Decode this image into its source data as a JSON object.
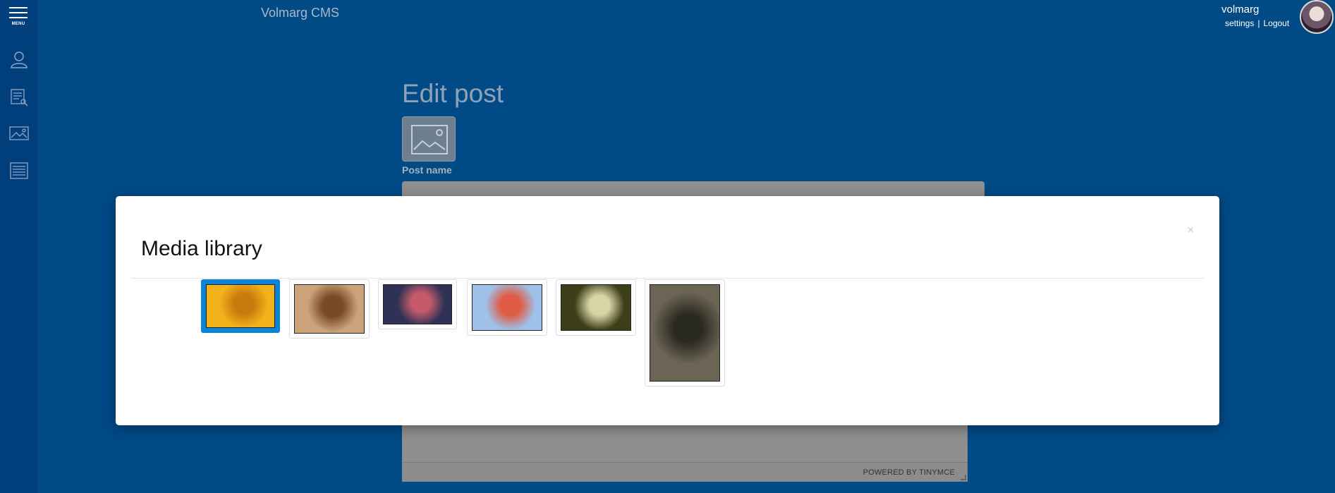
{
  "app": {
    "brand": "Volmarg CMS",
    "menu_label": "MENU"
  },
  "user": {
    "name": "volmarg",
    "settings_link": "settings",
    "separator": "|",
    "logout_link": "Logout"
  },
  "sidebar": {
    "icons": [
      {
        "name": "user-icon"
      },
      {
        "name": "posts-icon"
      },
      {
        "name": "media-icon"
      },
      {
        "name": "pages-icon"
      }
    ]
  },
  "page": {
    "title": "Edit post",
    "post_name_label": "Post name",
    "post_name_value": "",
    "editor_status": "POWERED BY TINYMCE"
  },
  "modal": {
    "title": "Media library",
    "close_label": "×",
    "images": [
      {
        "name": "media-item-bee-yellow-flower",
        "selected": true,
        "colors": [
          "#f2b21b",
          "#c97a0c"
        ]
      },
      {
        "name": "media-item-insect-brown",
        "selected": false,
        "colors": [
          "#caa37b",
          "#7a4a24"
        ]
      },
      {
        "name": "media-item-red-flowers-dark",
        "selected": false,
        "colors": [
          "#2e3355",
          "#c65a6a"
        ]
      },
      {
        "name": "media-item-pink-blossoms-sky",
        "selected": false,
        "colors": [
          "#9fc0e9",
          "#e05c44"
        ]
      },
      {
        "name": "media-item-white-flowers-green",
        "selected": false,
        "colors": [
          "#3d3f18",
          "#d9d4a6"
        ]
      },
      {
        "name": "media-item-fly-portrait",
        "selected": false,
        "colors": [
          "#6c6555",
          "#2b2a22"
        ]
      }
    ]
  }
}
